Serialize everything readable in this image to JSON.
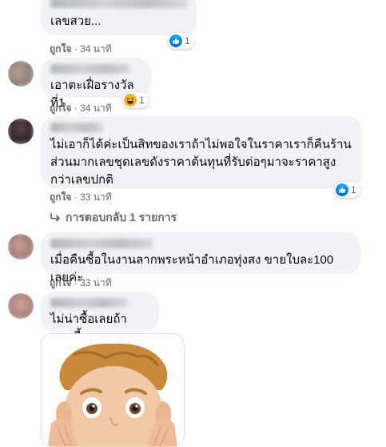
{
  "comments": [
    {
      "text": "เลขสวย...",
      "like_label": "ถูกใจ",
      "time": "34 นาที",
      "reaction": {
        "type": "like",
        "count": "1"
      }
    },
    {
      "text": "เอาตะเฝื่อรางวัลที่1",
      "like_label": "ถูกใจ",
      "time": "34 นาที",
      "reaction": {
        "type": "haha",
        "count": "1"
      }
    },
    {
      "text": "ไม่เอาก็ได้ค่ะเป็นสิทของเราถ้าไม่พอใจในราคาเราก็คืนร้าน ส่วนมากเลขชุดเลขดังราคาต้นทุนที่รับต่อๆมาจะราคาสูงกว่าเลขปกติ",
      "like_label": "ถูกใจ",
      "time": "33 นาที",
      "reaction": {
        "type": "like",
        "count": "1"
      }
    },
    {
      "text": "เมื่อคืนซื้อในงานลากพระหน้าอำเภอทุ่งสง ขายใบละ100 เลยค่ะ",
      "like_label": "ถูกใจ",
      "time": "33 นาที"
    },
    {
      "text": "ไม่น่าซื้อเลยถ้าแบบนี้"
    }
  ],
  "replies_link": "การตอบกลับ 1 รายการ",
  "meta_separator": "·",
  "icons": {
    "like": "like-icon",
    "haha": "haha-icon",
    "reply": "reply-arrow-icon"
  },
  "colors": {
    "bubble": "#f0f2f5",
    "meta": "#65676b",
    "like_blue": "#1877f2"
  }
}
